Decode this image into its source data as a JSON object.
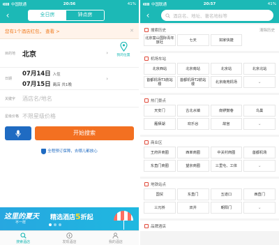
{
  "left": {
    "status": {
      "carrier": "中国联通",
      "time": "20:56",
      "battery": "41%"
    },
    "nav": {
      "back": "‹",
      "tabs": [
        "全日房",
        "钟点房"
      ]
    },
    "promo": {
      "text": "您有1个酒店红包，",
      "link": "查看 >",
      "close": "✕"
    },
    "destination": {
      "label": "目的地",
      "value": "北京",
      "location_label": "我的位置"
    },
    "dates": {
      "label": "日期",
      "checkin": "07月14日",
      "checkin_suffix": "入住",
      "checkout": "07月15日",
      "checkout_suffix": "离店 共1晚"
    },
    "keyword": {
      "label": "关键字",
      "placeholder": "酒店名/地名"
    },
    "star": {
      "label": "星级价格",
      "placeholder": "不限星级价格"
    },
    "search_button": "开始搜索",
    "guarantee": "全程预订保障，去哪儿都放心",
    "banner": {
      "line1": "这里的夏天",
      "line1b": "不一样",
      "line2a": "精选酒店",
      "line2b": "5",
      "line2c": "折起"
    },
    "tabbar": [
      {
        "label": "搜索酒店",
        "icon": "search-icon"
      },
      {
        "label": "发现酒店",
        "icon": "compass-icon"
      },
      {
        "label": "我的酒店",
        "icon": "person-icon"
      }
    ],
    "colors": {
      "teal": "#1cb9b6",
      "orange": "#f37021",
      "blue": "#1f6bc2"
    }
  },
  "right": {
    "status": {
      "carrier": "中国联通",
      "time": "20:57",
      "battery": "41%"
    },
    "nav": {
      "back": "‹",
      "search_placeholder": "酒店名、地址、著名地标等"
    },
    "sections": [
      {
        "title": "搜索历史",
        "extra": "清除历史",
        "items": [
          "北京富山国际青年旅社",
          "七天",
          "如家快捷"
        ]
      },
      {
        "title": "机场车站",
        "items": [
          "北京西站",
          "北京南站",
          "北京站",
          "北京北站",
          "首都机场T3航站楼",
          "首都机场T2航站楼",
          "北京南苑机场",
          "⌄"
        ]
      },
      {
        "title": "热门景点",
        "items": [
          "天安门",
          "古北水镇",
          "南锣鼓巷",
          "鸟巢",
          "雁栖湖",
          "欢乐谷",
          "故宫",
          "⌄"
        ]
      },
      {
        "title": "商业区",
        "items": [
          "王府井商圈",
          "西单商圈",
          "中关村商圈",
          "首都机场",
          "东直门商圈",
          "望京商圈",
          "三里屯、工体",
          "⌄"
        ]
      },
      {
        "title": "地铁站点",
        "items": [
          "国贸",
          "东直门",
          "五道口",
          "西直门",
          "三元桥",
          "双井",
          "朝阳门",
          "⌄"
        ]
      },
      {
        "title": "品牌酒店",
        "items": []
      }
    ]
  }
}
